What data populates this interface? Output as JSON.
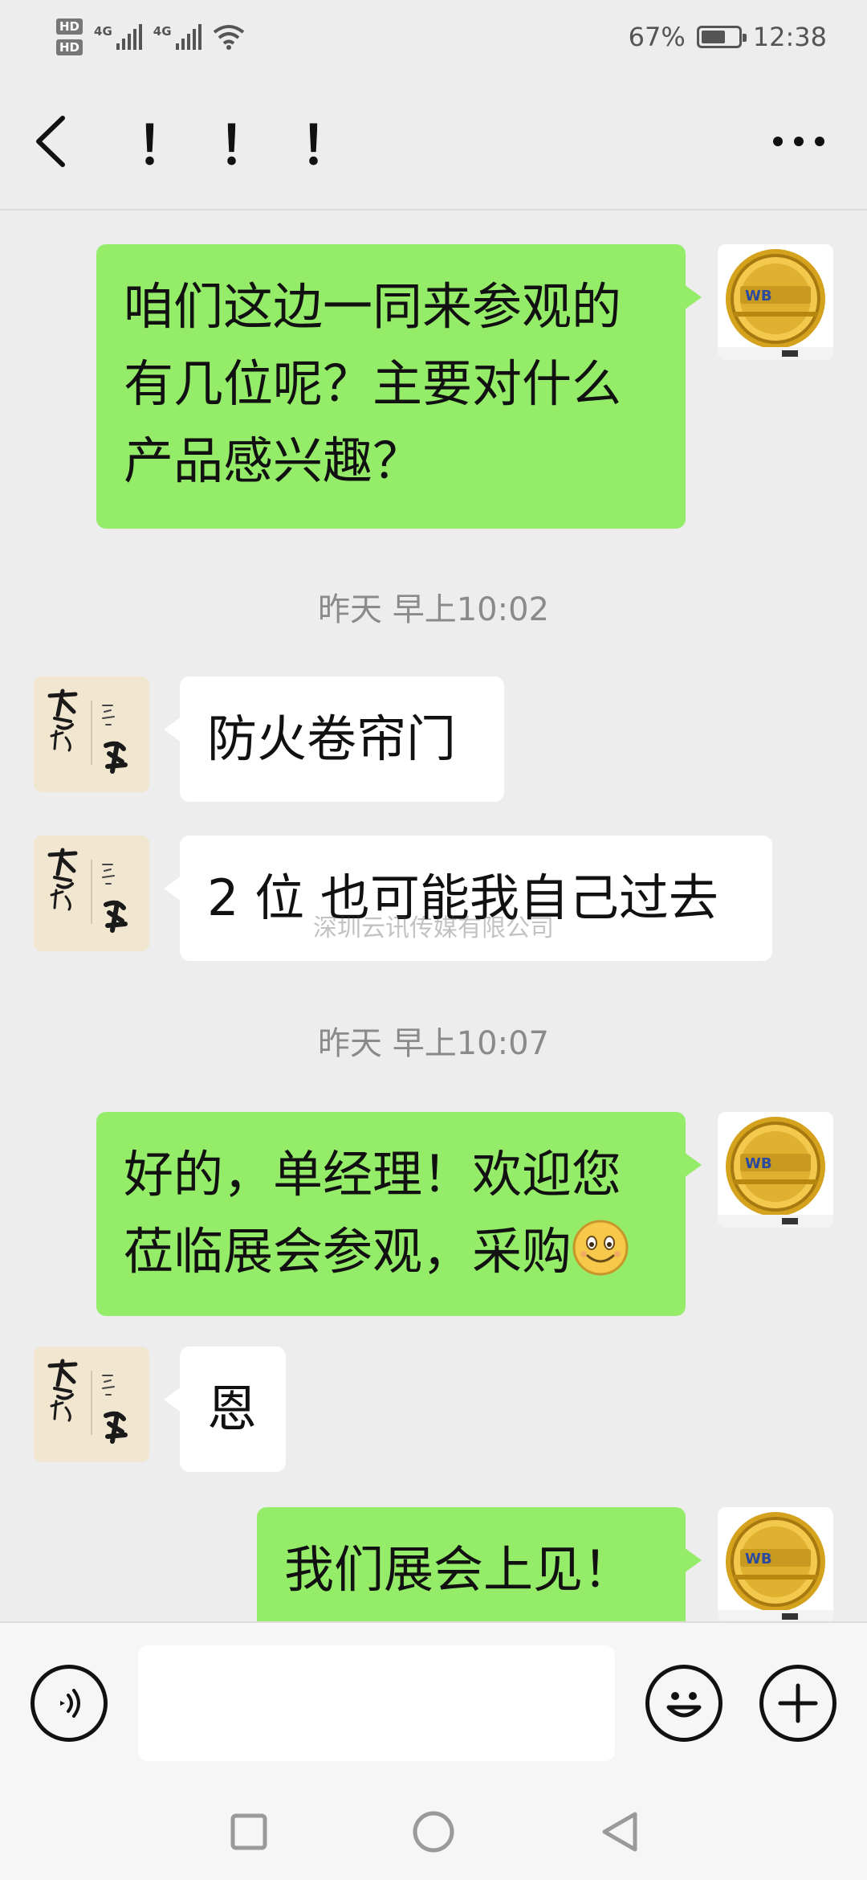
{
  "status_bar": {
    "hd1": "HD",
    "hd2": "HD",
    "net1": "4G",
    "net2": "4G",
    "battery_percent": "67%",
    "battery_level": 0.67,
    "time": "12:38"
  },
  "header": {
    "title": "！！！",
    "back_icon": "back-chevron-icon",
    "more_icon": "more-dots-icon"
  },
  "messages": [
    {
      "dir": "out",
      "text": "咱们这边一同来参观的有几位呢？主要对什么产品感兴趣？"
    },
    {
      "time": "昨天 早上10:02"
    },
    {
      "dir": "in",
      "text": "防火卷帘门"
    },
    {
      "dir": "in",
      "text": "2 位 也可能我自己过去"
    },
    {
      "time": "昨天 早上10:07"
    },
    {
      "dir": "out",
      "text": "好的，单经理！欢迎您莅临展会参观，采购",
      "emoji": "smile-emoji"
    },
    {
      "dir": "in",
      "text": "恩"
    },
    {
      "dir": "out",
      "text": "我们展会上见！"
    }
  ],
  "watermark": "深圳云讯传媒有限公司",
  "avatars": {
    "contact_text_top": "不忘初心",
    "contact_text_right": "方得始终",
    "self_logo_text": "WB 会展"
  },
  "input_bar": {
    "voice_icon": "voice-icon",
    "emoji_icon": "emoji-icon",
    "plus_icon": "plus-icon",
    "value": ""
  },
  "nav": {
    "recents_icon": "square-icon",
    "home_icon": "circle-icon",
    "back_icon": "triangle-back-icon"
  }
}
